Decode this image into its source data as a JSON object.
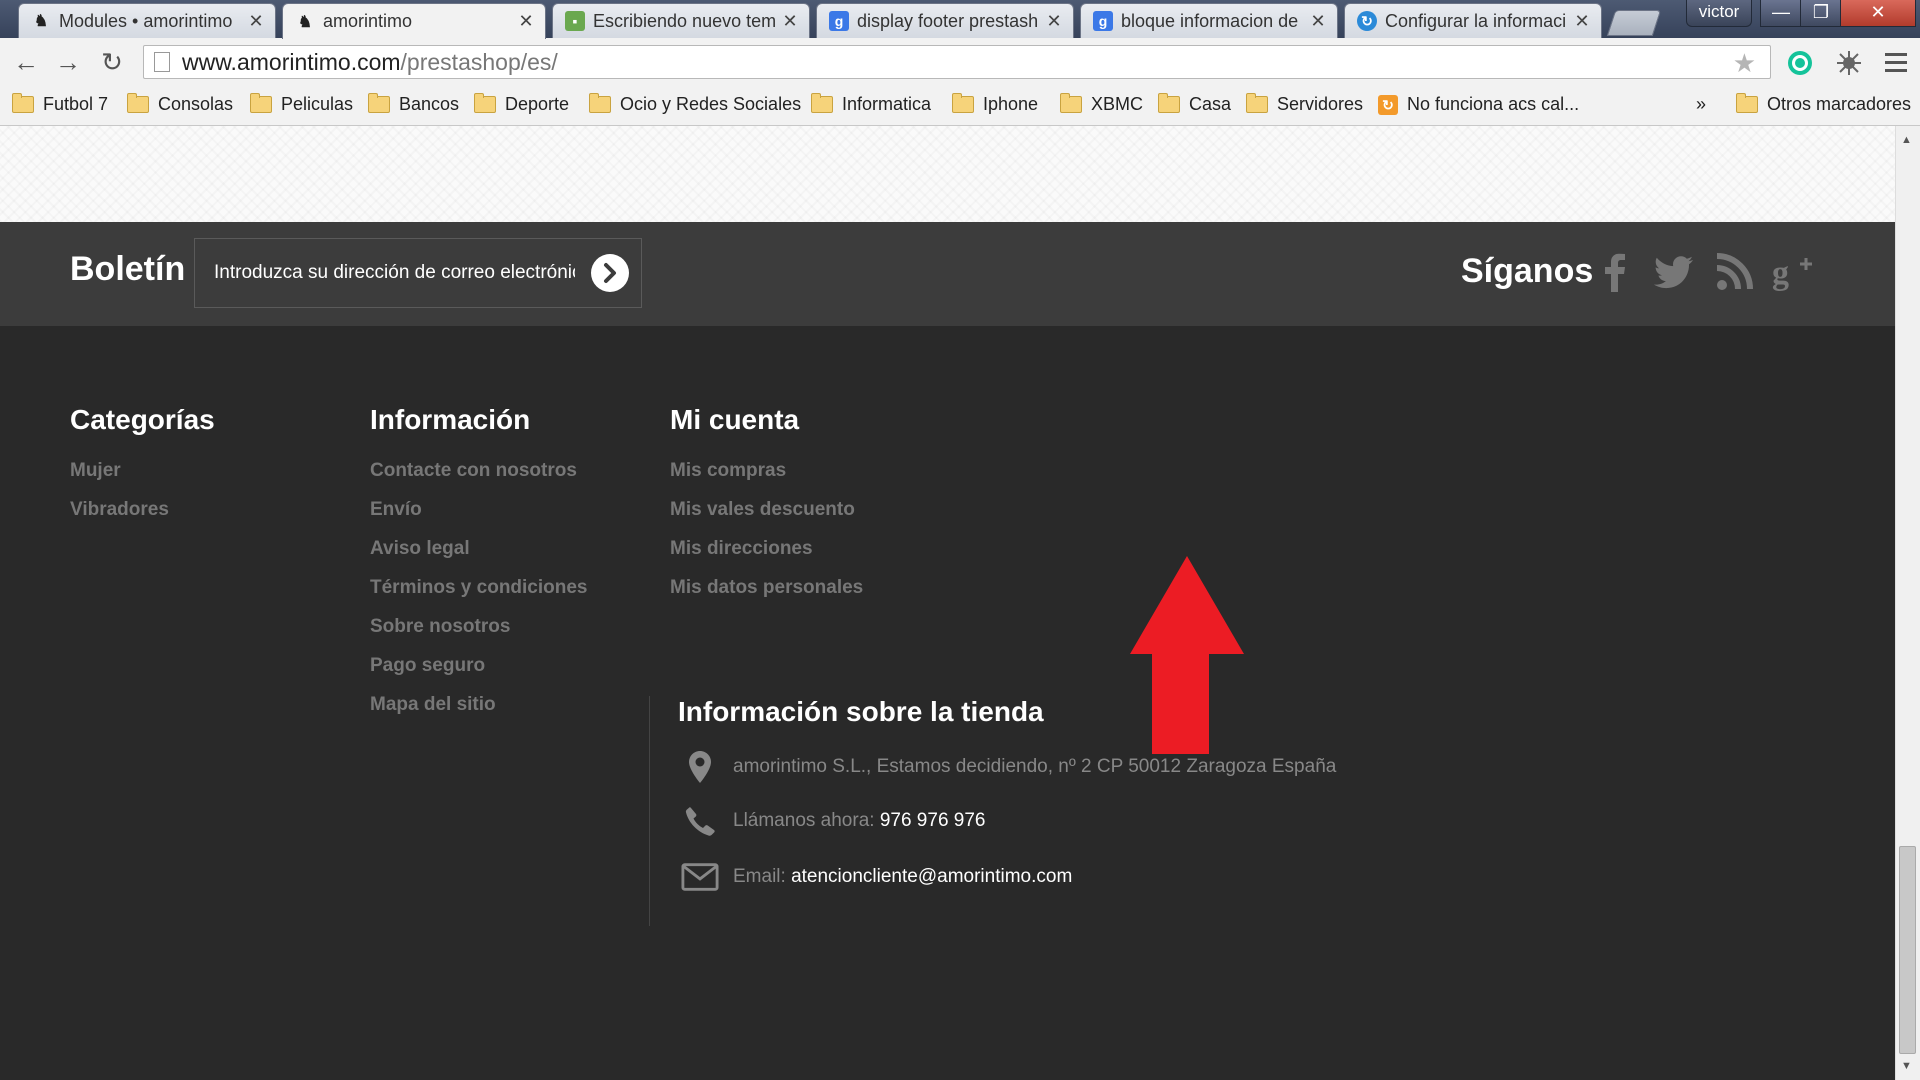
{
  "browser": {
    "tabs": [
      {
        "label": "Modules • amorintimo",
        "icon": "prestashop-puffin-icon"
      },
      {
        "label": "amorintimo",
        "icon": "prestashop-puffin-icon",
        "active": true
      },
      {
        "label": "Escribiendo nuevo tem",
        "icon": "forum-icon"
      },
      {
        "label": "display footer prestash",
        "icon": "google-icon"
      },
      {
        "label": "bloque informacion de",
        "icon": "google-icon"
      },
      {
        "label": "Configurar la informaci",
        "icon": "prestashop-config-icon"
      }
    ],
    "profile": "victor",
    "window_controls": {
      "minimize": "—",
      "restore": "❐",
      "close": "✕"
    },
    "nav": {
      "back": "←",
      "forward": "→",
      "reload": "↻"
    },
    "address": {
      "domain": "www.amorintimo.com",
      "path": "/prestashop/es/"
    },
    "star": "★",
    "bookmarks": [
      "Futbol 7",
      "Consolas",
      "Peliculas",
      "Bancos",
      "Deporte",
      "Ocio y Redes Sociales",
      "Informatica",
      "Iphone",
      "XBMC",
      "Casa",
      "Servidores",
      "No funciona acs cal..."
    ],
    "bookmarks_overflow": "»",
    "other_bookmarks": "Otros marcadores"
  },
  "footer": {
    "newsletter": {
      "title": "Boletín",
      "placeholder": "Introduzca su dirección de correo electrónico"
    },
    "follow": {
      "title": "Síganos",
      "networks": [
        "facebook-icon",
        "twitter-icon",
        "rss-icon",
        "google-plus-icon"
      ]
    },
    "categories": {
      "title": "Categorías",
      "links": [
        "Mujer",
        "Vibradores"
      ]
    },
    "information": {
      "title": "Información",
      "links": [
        "Contacte con nosotros",
        "Envío",
        "Aviso legal",
        "Términos y condiciones",
        "Sobre nosotros",
        "Pago seguro",
        "Mapa del sitio"
      ]
    },
    "account": {
      "title": "Mi cuenta",
      "links": [
        "Mis compras",
        "Mis vales descuento",
        "Mis direcciones",
        "Mis datos personales"
      ]
    },
    "store_info": {
      "title": "Información sobre la tienda",
      "address": "amorintimo S.L., Estamos decidiendo, nº 2 CP 50012 Zaragoza España",
      "phone_label": "Llámanos ahora:",
      "phone": "976 976 976",
      "email_label": "Email:",
      "email": "atencioncliente@amorintimo.com"
    }
  },
  "annotation": {
    "color": "#ec1c24",
    "icon": "red-up-arrow"
  },
  "colors": {
    "footer_bg": "#292929",
    "newsletter_bg": "#3c3c3c",
    "link": "#777777",
    "heading": "#ffffff"
  }
}
